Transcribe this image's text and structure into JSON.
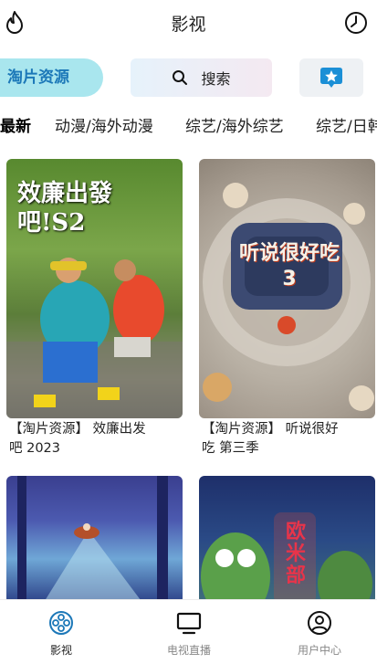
{
  "header": {
    "title": "影视",
    "left_icon": "fire-icon",
    "right_icon": "history-clock-icon"
  },
  "actions": {
    "source_label": "淘片资源",
    "search_label": "搜索",
    "fav_icon": "star-badge-icon"
  },
  "tabs": [
    {
      "label": "最新",
      "active": true
    },
    {
      "label": "动漫/海外动漫"
    },
    {
      "label": "综艺/海外综艺"
    },
    {
      "label": "综艺/日韩"
    }
  ],
  "cards": [
    {
      "title": "【淘片资源】 效廉出发吧 2023",
      "poster_text": "效廉出發吧!S2"
    },
    {
      "title": "【淘片资源】 听说很好吃 第三季",
      "poster_text": "听说很好吃 3"
    },
    {
      "title": "",
      "poster_text": ""
    },
    {
      "title": "",
      "poster_text": "欧米部"
    }
  ],
  "navbar": {
    "items": [
      {
        "label": "影视",
        "icon": "film-reel-icon",
        "active": true
      },
      {
        "label": "电视直播",
        "icon": "tv-icon"
      },
      {
        "label": "用户中心",
        "icon": "user-circle-icon"
      }
    ]
  },
  "colors": {
    "accent": "#1c78b8",
    "pill": "#a9e6ee",
    "fav": "#1b8fd6"
  }
}
